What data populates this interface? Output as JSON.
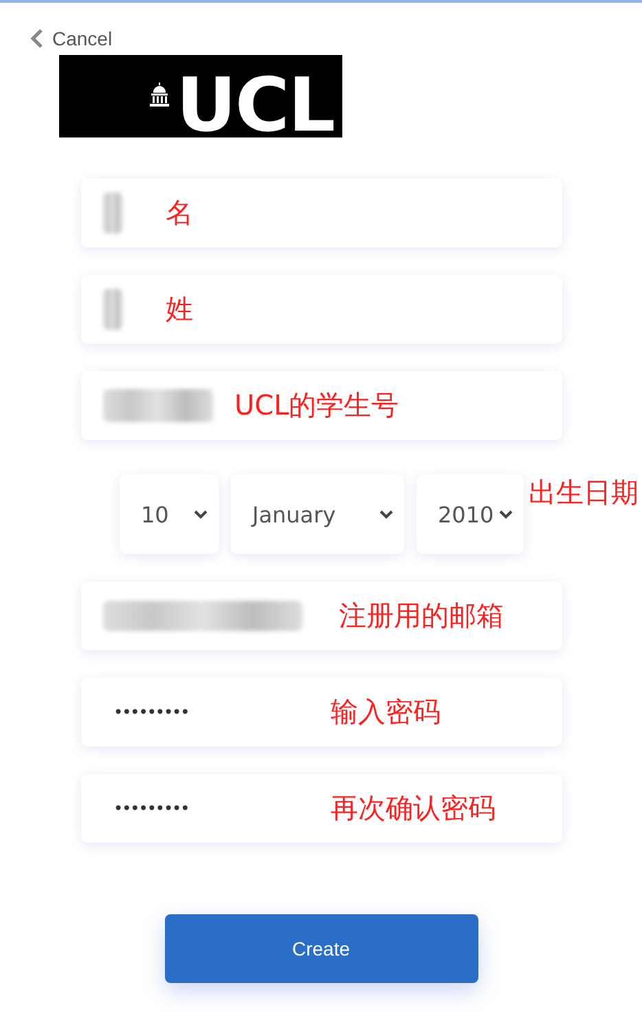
{
  "back": {
    "label": "Cancel"
  },
  "logo": {
    "text": "UCL"
  },
  "fields": [
    {
      "kind": "redacted",
      "note": "名"
    },
    {
      "kind": "redacted",
      "note": "姓"
    },
    {
      "kind": "redacted",
      "note": "UCL的学生号"
    },
    {
      "kind": "date",
      "selects": [
        {
          "value": "10"
        },
        {
          "value": "January"
        },
        {
          "value": "2010"
        }
      ],
      "note": "出生日期"
    },
    {
      "kind": "redacted",
      "note": "注册用的邮箱"
    },
    {
      "kind": "password",
      "value": "•••••••••",
      "note": "输入密码"
    },
    {
      "kind": "password",
      "value": "•••••••••",
      "note": "再次确认密码"
    }
  ],
  "submit": {
    "label": "Create"
  }
}
